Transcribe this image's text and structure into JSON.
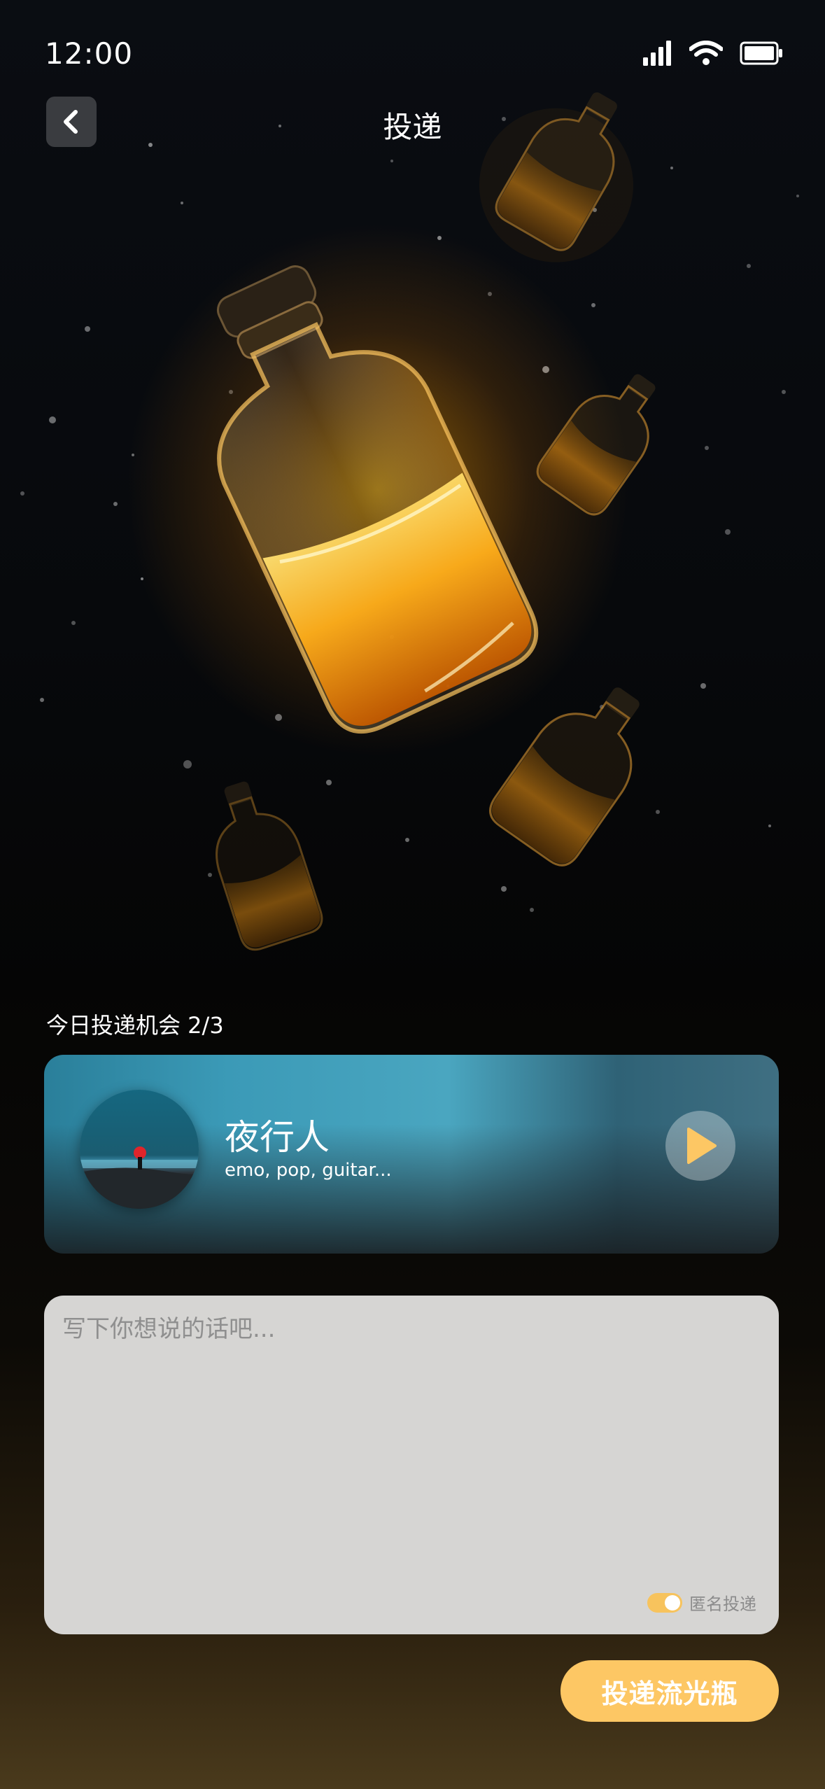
{
  "status_bar": {
    "time": "12:00",
    "icons": [
      "signal-icon",
      "wifi-icon",
      "battery-icon"
    ]
  },
  "nav": {
    "title": "投递",
    "back_icon": "chevron-left-icon"
  },
  "hero": {
    "image": "glowing-bottles-illustration"
  },
  "delivery": {
    "chances_label": "今日投递机会 2/3"
  },
  "song": {
    "title": "夜行人",
    "tags": "emo, pop, guitar...",
    "play_icon": "play-icon"
  },
  "message": {
    "placeholder": "写下你想说的话吧...",
    "anonymous_label": "匿名投递",
    "anonymous_enabled": true
  },
  "actions": {
    "submit_label": "投递流光瓶"
  },
  "colors": {
    "accent": "#fdc764",
    "card_blue": "#3b9ab7",
    "input_bg": "#d6d5d3"
  }
}
